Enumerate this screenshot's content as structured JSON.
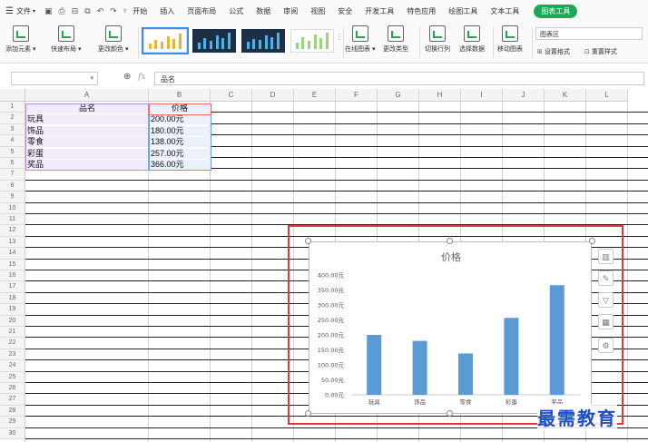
{
  "menu": {
    "file": "文件",
    "tabs": [
      "开始",
      "插入",
      "页面布局",
      "公式",
      "数据",
      "审阅",
      "视图",
      "安全",
      "开发工具",
      "特色应用",
      "绘图工具",
      "文本工具"
    ],
    "active_tab": "图表工具"
  },
  "ribbon": {
    "add_element": "添加元素",
    "quick_layout": "快速布局",
    "change_color": "更改颜色",
    "online_chart": "在线图表",
    "change_type": "更改类型",
    "switch_row_col": "切换行列",
    "select_data": "选择数据",
    "move_chart": "移动图表",
    "chart_area": "图表区",
    "set_format": "设置格式",
    "reset_style": "重置样式"
  },
  "formula_bar": {
    "fx": "fx",
    "content": "品名"
  },
  "columns": [
    "A",
    "B",
    "C",
    "D",
    "E",
    "F",
    "G",
    "H",
    "I",
    "J",
    "K",
    "L"
  ],
  "rows": [
    "1",
    "2",
    "3",
    "4",
    "5",
    "6",
    "7",
    "8",
    "9",
    "10",
    "11",
    "12",
    "13",
    "14",
    "15",
    "16",
    "17",
    "18",
    "19",
    "20",
    "21",
    "22",
    "23",
    "24",
    "25",
    "26",
    "27",
    "28",
    "29",
    "30"
  ],
  "table": {
    "headers": [
      "品名",
      "价格"
    ],
    "rows": [
      [
        "玩具",
        "200.00元"
      ],
      [
        "饰品",
        "180.00元"
      ],
      [
        "零食",
        "138.00元"
      ],
      [
        "彩蛋",
        "257.00元"
      ],
      [
        "奖品",
        "366.00元"
      ]
    ]
  },
  "chart_data": {
    "type": "bar",
    "title": "价格",
    "categories": [
      "玩具",
      "饰品",
      "零食",
      "彩蛋",
      "奖品"
    ],
    "values": [
      200,
      180,
      138,
      257,
      366
    ],
    "yticks": [
      "0.00元",
      "50.00元",
      "100.00元",
      "150.00元",
      "200.00元",
      "250.00元",
      "300.00元",
      "350.00元",
      "400.00元"
    ],
    "ylim": [
      0,
      400
    ],
    "bar_color": "#5b9bd5",
    "grid": false
  },
  "watermark": "最需教育",
  "colors": {
    "accent": "#1aaa55",
    "highlight_box": "#e53935"
  }
}
